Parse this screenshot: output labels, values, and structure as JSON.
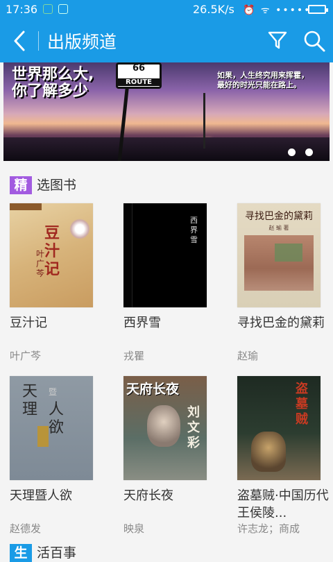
{
  "status_bar": {
    "time": "17:36",
    "net_speed": "26.5K/s",
    "right_icons": "⏰ ᯤ •••••"
  },
  "nav": {
    "title": "出版频道",
    "accent_color": "#1a9be6"
  },
  "banner": {
    "headline_line1": "世界那么大,",
    "headline_line2": "你了解多少",
    "caption_line1": "如果，人生终究用来挥霍，",
    "caption_line2": "最好的时光只能在路上。",
    "sign_number": "66",
    "sign_label": "ROUTE",
    "slides": 2
  },
  "section_featured": {
    "tag": "精",
    "title": "选图书"
  },
  "books": [
    {
      "title": "豆汁记",
      "author": "叶广芩",
      "cover_title": "豆汁记",
      "cover_author": "叶广芩"
    },
    {
      "title": "西界雪",
      "author": "戎瞿",
      "cover_title": "西界雪"
    },
    {
      "title": "寻找巴金的黛莉",
      "author": "赵瑜",
      "cover_title": "寻找巴金的黛莉",
      "cover_author": "赵 瑜 著"
    },
    {
      "title": "天理暨人欲",
      "author": "赵德发",
      "cover_t1": "天理",
      "cover_t2": "人欲",
      "cover_t3": "暨"
    },
    {
      "title": "天府长夜",
      "author": "映泉",
      "cover_title": "天府长夜",
      "cover_name": "刘文彩"
    },
    {
      "title": "盗墓贼·中国历代王侯陵...",
      "author": "许志龙；商成",
      "cover_title": "盗墓贼"
    }
  ],
  "section_next": {
    "tag": "生",
    "title": "活百事"
  }
}
